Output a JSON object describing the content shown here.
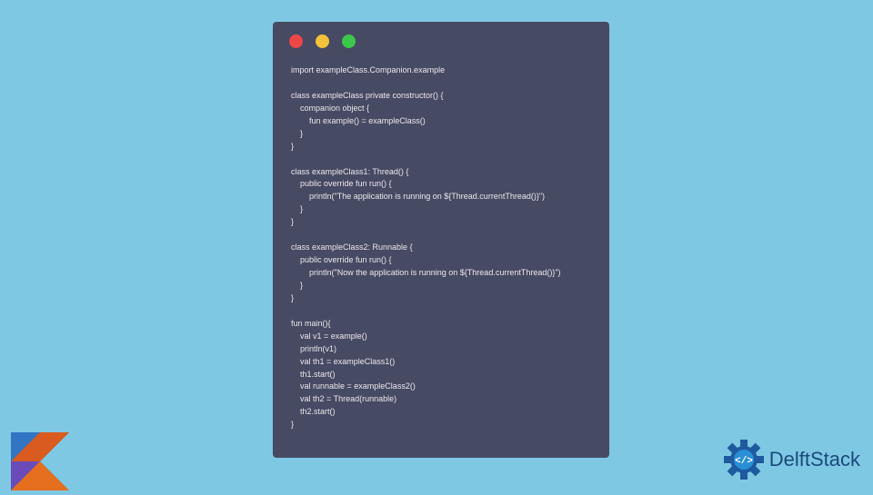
{
  "code": {
    "lines": [
      "import exampleClass.Companion.example",
      "",
      "class exampleClass private constructor() {",
      "    companion object {",
      "        fun example() = exampleClass()",
      "    }",
      "}",
      "",
      "class exampleClass1: Thread() {",
      "    public override fun run() {",
      "        println(\"The application is running on ${Thread.currentThread()}\")",
      "    }",
      "}",
      "",
      "class exampleClass2: Runnable {",
      "    public override fun run() {",
      "        println(\"Now the application is running on ${Thread.currentThread()}\")",
      "    }",
      "}",
      "",
      "fun main(){",
      "    val v1 = example()",
      "    println(v1)",
      "    val th1 = exampleClass1()",
      "    th1.start()",
      "    val runnable = exampleClass2()",
      "    val th2 = Thread(runnable)",
      "    th2.start()",
      "}"
    ]
  },
  "branding": {
    "delft_label": "DelftStack"
  }
}
